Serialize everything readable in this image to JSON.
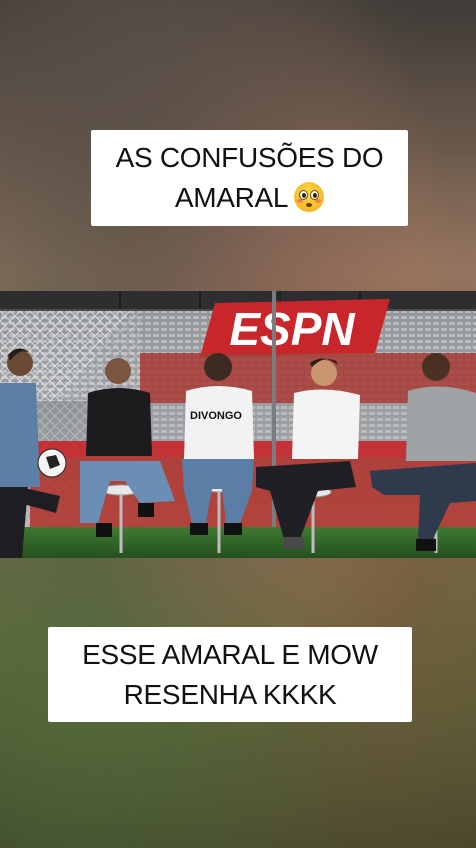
{
  "captions": {
    "top_line1": "AS CONFUSÕES DO",
    "top_line2": "AMARAL",
    "top_emoji": "flushed-face-emoji",
    "bottom_line1": "ESSE AMARAL E MOW",
    "bottom_line2": "RESENHA KKKK"
  },
  "video": {
    "brand_text": "ESPN",
    "shirt_text": "DIVONGO"
  },
  "colors": {
    "caption_bg": "#ffffff",
    "caption_text": "#111111",
    "brand_red": "#c8262a",
    "studio_floor": "#2f6a2a"
  }
}
